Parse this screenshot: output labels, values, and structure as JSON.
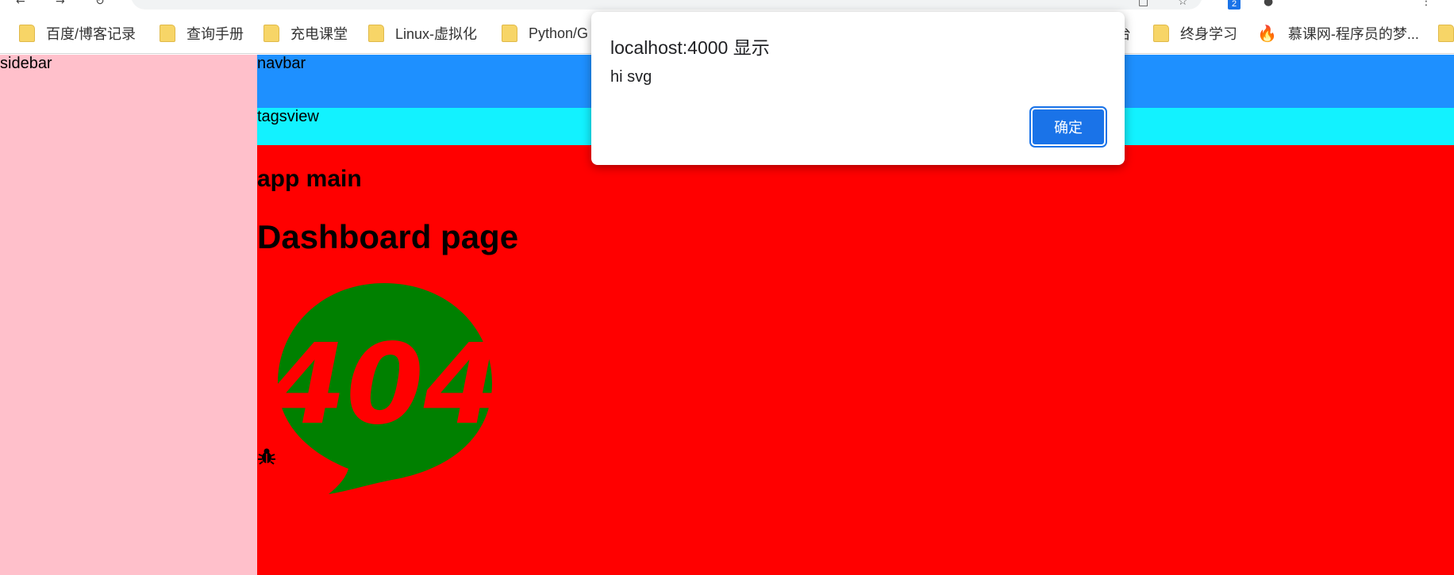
{
  "bookmarks": [
    {
      "label": "百度/博客记录",
      "icon": "folder-icon"
    },
    {
      "label": "查询手册",
      "icon": "folder-icon"
    },
    {
      "label": "充电课堂",
      "icon": "folder-icon"
    },
    {
      "label": "Linux-虚拟化",
      "icon": "folder-icon"
    },
    {
      "label": "Python/G",
      "icon": "folder-icon"
    },
    {
      "label": "台",
      "icon": ""
    },
    {
      "label": "终身学习",
      "icon": "folder-icon"
    },
    {
      "label": "慕课网-程序员的梦...",
      "icon": "fire-icon"
    }
  ],
  "toolbar": {
    "lang_badge": "2"
  },
  "layout_labels": {
    "sidebar": "sidebar",
    "navbar": "navbar",
    "tagsview": "tagsview"
  },
  "main": {
    "app_main": "app main",
    "page_title": "Dashboard page",
    "svg_text": "404"
  },
  "dialog": {
    "title": "localhost:4000 显示",
    "message": "hi svg",
    "ok_label": "确定"
  },
  "colors": {
    "sidebar_bg": "#ffc0cb",
    "navbar_bg": "#1e90ff",
    "tagsview_bg": "#12f2ff",
    "main_bg": "#ff0000",
    "svg_fill": "#008000",
    "dialog_button": "#1a73e8"
  }
}
